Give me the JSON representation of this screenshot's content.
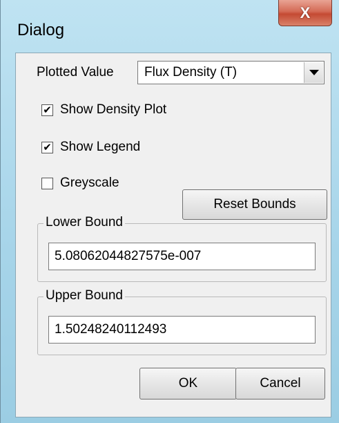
{
  "window": {
    "title": "Dialog",
    "close_glyph": "X"
  },
  "plotted_value": {
    "label": "Plotted Value",
    "selected": "Flux Density (T)"
  },
  "checkboxes": {
    "show_density_plot": {
      "label": "Show Density Plot",
      "checked": true,
      "mark": "✔"
    },
    "show_legend": {
      "label": "Show Legend",
      "checked": true,
      "mark": "✔"
    },
    "greyscale": {
      "label": "Greyscale",
      "checked": false,
      "mark": ""
    }
  },
  "reset_bounds_label": "Reset Bounds",
  "lower_bound": {
    "legend": "Lower Bound",
    "value": "5.08062044827575e-007"
  },
  "upper_bound": {
    "legend": "Upper Bound",
    "value": "1.50248240112493"
  },
  "buttons": {
    "ok": "OK",
    "cancel": "Cancel"
  }
}
